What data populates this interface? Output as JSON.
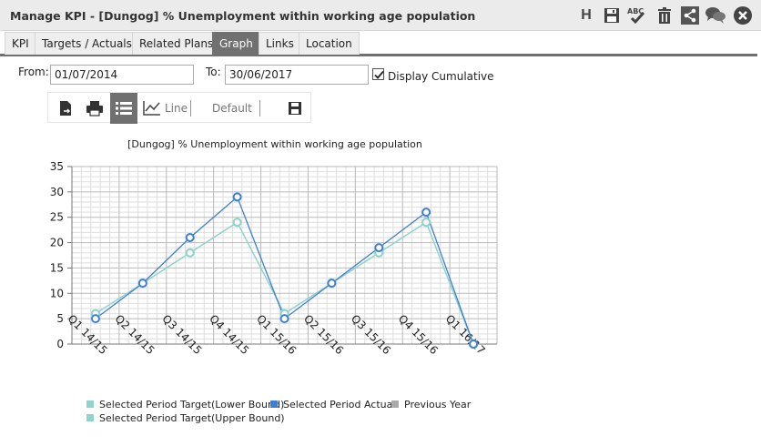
{
  "window": {
    "title": "Manage KPI - [Dungog] % Unemployment within working age population",
    "icons": [
      "h-icon",
      "save-icon",
      "spellcheck-icon",
      "delete-icon",
      "share-icon",
      "comments-icon",
      "close-icon"
    ],
    "h_label": "H",
    "spell_label": "ABC"
  },
  "tabs": [
    {
      "label": "KPI",
      "active": false
    },
    {
      "label": "Targets / Actuals",
      "active": false
    },
    {
      "label": "Related Plans",
      "active": false
    },
    {
      "label": "Graph",
      "active": true
    },
    {
      "label": "Links",
      "active": false
    },
    {
      "label": "Location",
      "active": false
    }
  ],
  "filters": {
    "from_label": "From:",
    "from_value": "01/07/2014",
    "to_label": "To:",
    "to_value": "30/06/2017",
    "cumulative_label": "Display Cumulative",
    "cumulative_checked": true
  },
  "toolbar": {
    "line_label": "Line",
    "default_label": "Default"
  },
  "colors": {
    "lower": "#8ed3cc",
    "actual": "#3e7fd3",
    "previous": "#aaaaaa",
    "upper": "#8ed3cc"
  },
  "chart_data": {
    "type": "line",
    "title": "[Dungog] % Unemployment within working age population",
    "categories": [
      "Q1 14/15",
      "Q2 14/15",
      "Q3 14/15",
      "Q4 14/15",
      "Q1 15/16",
      "Q2 15/16",
      "Q3 15/16",
      "Q4 15/16",
      "Q1 16/17"
    ],
    "ylim": [
      0,
      35
    ],
    "yticks": [
      0,
      5,
      10,
      15,
      20,
      25,
      30,
      35
    ],
    "grid": true,
    "legend_position": "bottom",
    "series": [
      {
        "name": "Selected Period Target(Lower Bound)",
        "values": [
          6,
          12,
          18,
          24,
          6,
          12,
          18,
          24,
          0
        ]
      },
      {
        "name": "Selected Period Actual",
        "values": [
          5,
          12,
          21,
          29,
          5,
          12,
          19,
          26,
          0
        ]
      },
      {
        "name": "Previous Year",
        "values": []
      },
      {
        "name": "Selected Period Target(Upper Bound)",
        "values": [
          6,
          12,
          18,
          24,
          6,
          12,
          18,
          24,
          0
        ]
      }
    ]
  }
}
